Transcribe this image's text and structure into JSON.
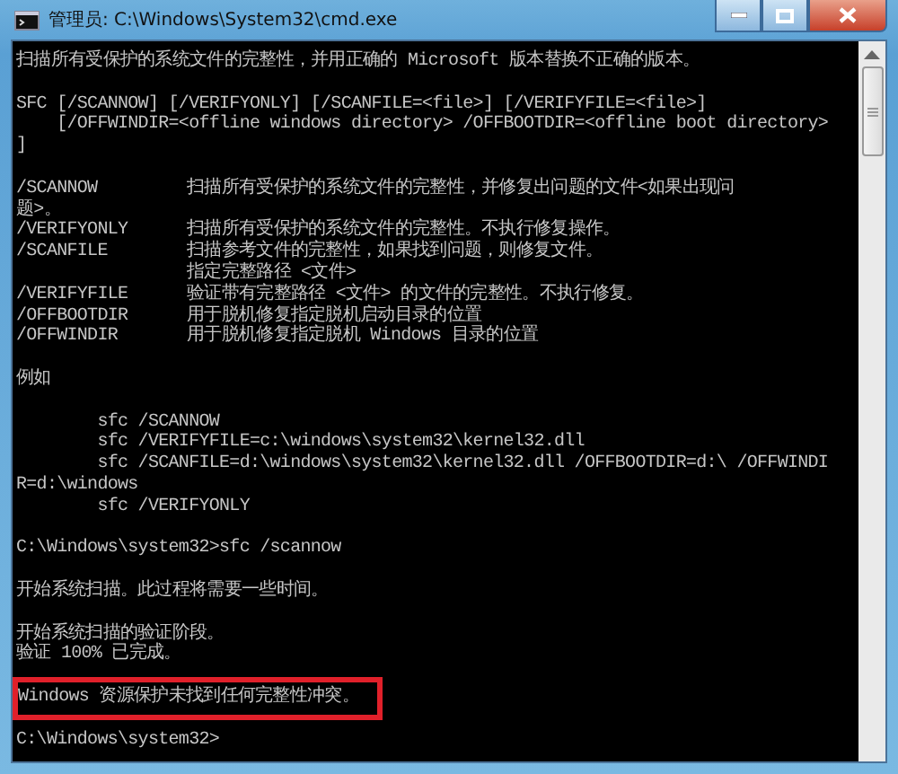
{
  "window": {
    "title": "管理员: C:\\Windows\\System32\\cmd.exe"
  },
  "console": {
    "blocks": [
      {
        "kind": "text",
        "lines": [
          "扫描所有受保护的系统文件的完整性，并用正确的 Microsoft 版本替换不正确的版本。"
        ]
      },
      {
        "kind": "text",
        "lines": [
          "SFC [/SCANNOW] [/VERIFYONLY] [/SCANFILE=<file>] [/VERIFYFILE=<file>]",
          "    [/OFFWINDIR=<offline windows directory> /OFFBOOTDIR=<offline boot directory>",
          "]"
        ]
      },
      {
        "kind": "options",
        "rows": [
          {
            "option": "/SCANNOW",
            "lines": [
              "扫描所有受保护的系统文件的完整性，并修复出问题的文件<如果出现问",
              "题>。"
            ]
          },
          {
            "option": "/VERIFYONLY",
            "lines": [
              "扫描所有受保护的系统文件的完整性。不执行修复操作。"
            ]
          },
          {
            "option": "/SCANFILE",
            "lines": [
              "扫描参考文件的完整性，如果找到问题，则修复文件。",
              "指定完整路径 <文件>"
            ]
          },
          {
            "option": "/VERIFYFILE",
            "lines": [
              "验证带有完整路径 <文件> 的文件的完整性。不执行修复。"
            ]
          },
          {
            "option": "/OFFBOOTDIR",
            "lines": [
              "用于脱机修复指定脱机启动目录的位置"
            ]
          },
          {
            "option": "/OFFWINDIR",
            "lines": [
              "用于脱机修复指定脱机 Windows 目录的位置"
            ]
          }
        ]
      },
      {
        "kind": "text",
        "lines": [
          "例如"
        ]
      },
      {
        "kind": "text",
        "lines": [
          "        sfc /SCANNOW",
          "        sfc /VERIFYFILE=c:\\windows\\system32\\kernel32.dll",
          "        sfc /SCANFILE=d:\\windows\\system32\\kernel32.dll /OFFBOOTDIR=d:\\ /OFFWINDI",
          "R=d:\\windows",
          "        sfc /VERIFYONLY"
        ]
      },
      {
        "kind": "text",
        "lines": [
          "C:\\Windows\\system32>sfc /scannow"
        ]
      },
      {
        "kind": "text",
        "lines": [
          "开始系统扫描。此过程将需要一些时间。"
        ]
      },
      {
        "kind": "text",
        "lines": [
          "开始系统扫描的验证阶段。",
          "验证 100% 已完成。"
        ]
      },
      {
        "kind": "highlight",
        "lines": [
          "Windows 资源保护未找到任何完整性冲突。"
        ]
      },
      {
        "kind": "text",
        "lines": [
          "C:\\Windows\\system32>"
        ]
      }
    ]
  }
}
